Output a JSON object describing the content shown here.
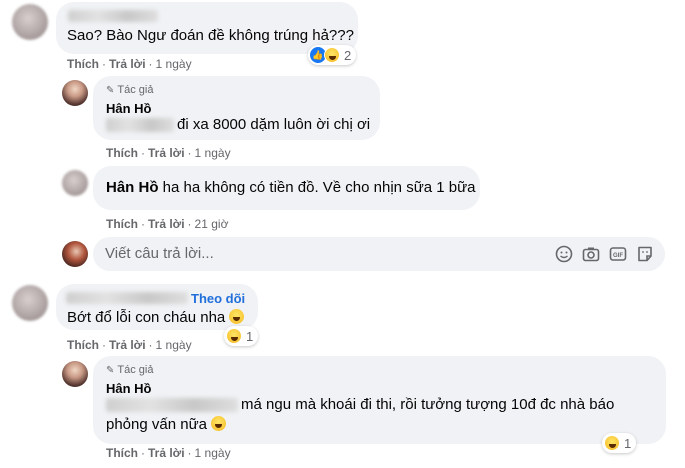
{
  "comments": [
    {
      "text": "Sao? Bào Ngư đoán đề không trúng hả???",
      "actions": {
        "like": "Thích",
        "reply": "Trả lời",
        "time": "1 ngày"
      },
      "reactions": {
        "count": "2",
        "icons": [
          "like-icon",
          "haha-icon"
        ]
      }
    },
    {
      "author_tag": "Tác giả",
      "author": "Hân Hồ",
      "text": "đi xa 8000 dặm luôn ời chị ơi",
      "actions": {
        "like": "Thích",
        "reply": "Trả lời",
        "time": "1 ngày"
      }
    },
    {
      "author": "Hân Hồ",
      "text": "ha ha không có tiền đồ. Về cho nhịn sữa 1 bữa",
      "actions": {
        "like": "Thích",
        "reply": "Trả lời",
        "time": "21 giờ"
      }
    },
    {
      "follow": "Theo dõi",
      "text": "Bớt đổ lỗi con cháu nha",
      "actions": {
        "like": "Thích",
        "reply": "Trả lời",
        "time": "1 ngày"
      },
      "reactions": {
        "count": "1",
        "icons": [
          "haha-icon"
        ]
      }
    },
    {
      "author_tag": "Tác giả",
      "author": "Hân Hồ",
      "text_line1": "má ngu mà khoái đi thi, rồi tưởng tượng 10đ đc nhà báo",
      "text_line2": "phỏng vấn nữa",
      "actions": {
        "like": "Thích",
        "reply": "Trả lời",
        "time": "1 ngày"
      },
      "reactions": {
        "count": "1",
        "icons": [
          "haha-icon"
        ]
      }
    }
  ],
  "reply_box": {
    "placeholder": "Viết câu trả lời..."
  },
  "colors": {
    "bubble": "#f0f2f5",
    "meta": "#65676b",
    "link": "#216fdb",
    "like": "#1877f2"
  }
}
